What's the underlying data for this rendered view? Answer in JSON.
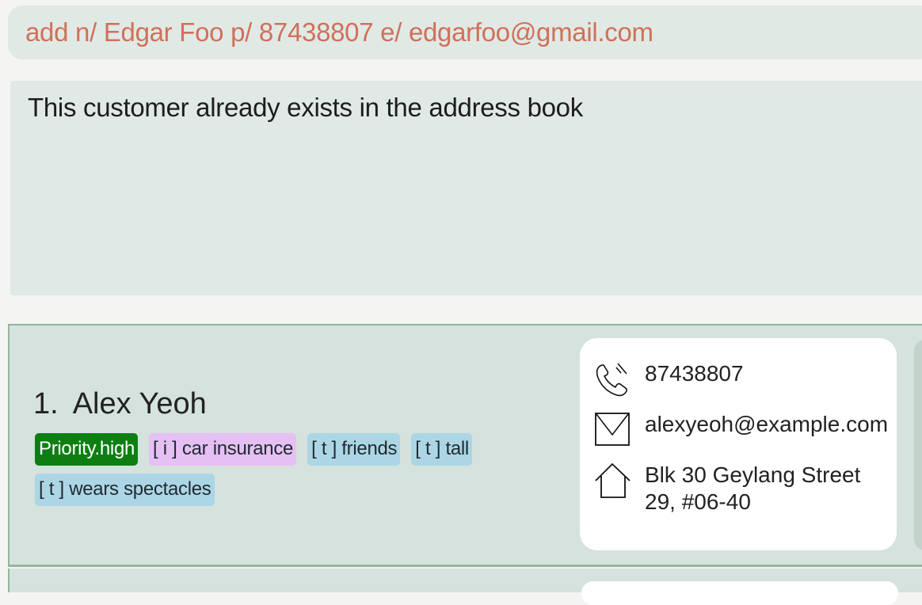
{
  "command_box": {
    "text": "add n/ Edgar Foo p/ 87438807 e/ edgarfoo@gmail.com"
  },
  "result_display": {
    "message": "This customer already exists in the address book"
  },
  "persons": [
    {
      "index": "1.",
      "name": "Alex Yeoh",
      "tags": [
        {
          "text": "Priority.high",
          "kind": "priority"
        },
        {
          "text": "[ i ] car insurance",
          "kind": "insurance"
        },
        {
          "text": "[ t ] friends",
          "kind": "t"
        },
        {
          "text": "[ t ] tall",
          "kind": "t"
        },
        {
          "text": "[ t ] wears spectacles",
          "kind": "t"
        }
      ],
      "phone": "87438807",
      "email": "alexyeoh@example.com",
      "address_line1": "Blk 30 Geylang Street",
      "address_line2": "29, #06-40",
      "icons": {
        "phone": "phone-icon",
        "email": "envelope-icon",
        "address": "house-icon"
      }
    }
  ],
  "colors": {
    "command_text": "#d0705a",
    "priority_tag": "#0d7f12",
    "insurance_tag": "#e6c0f5",
    "t_tag": "#acd6e5",
    "card_border": "#97b49b"
  }
}
